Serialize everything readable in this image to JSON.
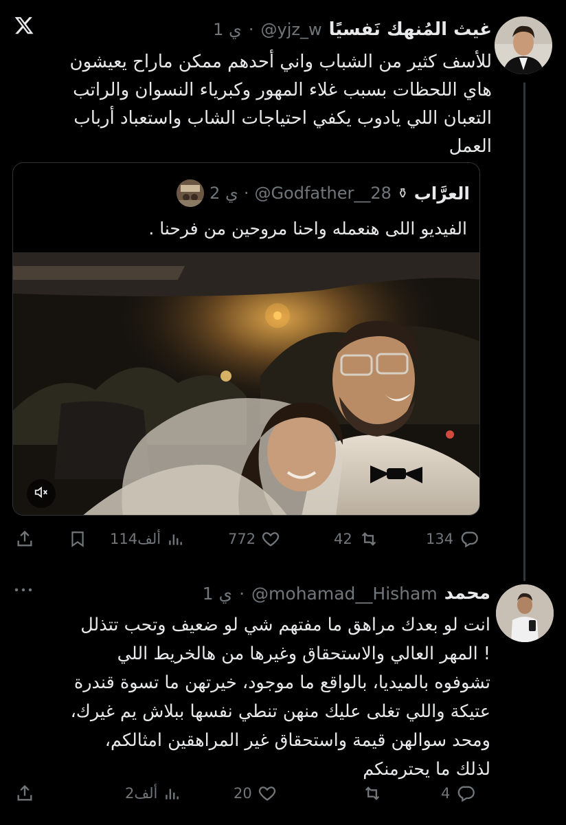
{
  "tweet": {
    "display_name": "غيث المُنهك نَفسيًا",
    "handle": "@yjz_w",
    "time": "1 ي",
    "text_lines": [
      "للأسف كثير من الشباب واني أحدهم ممكن ماراح يعيشون",
      "هاي اللحظات بسبب غلاء المهور وكبرياء النسوان والراتب",
      "التعبان اللي يادوب يكفي احتياجات الشاب واستعباد أرباب",
      "العمل"
    ],
    "quote": {
      "display_name": "العرَّاب",
      "badge": "⚱",
      "handle": "@Godfather__28",
      "time": "2 ي",
      "text": "الفيديو اللى هنعمله واحنا مروحين من فرحنا ."
    },
    "actions": {
      "replies": "134",
      "retweets": "42",
      "likes": "772",
      "views": "114ألف"
    }
  },
  "reply": {
    "display_name": "محمد",
    "handle": "@mohamad__Hisham",
    "time": "1 ي",
    "text_lines": [
      "انت لو بعدك مراهق ما مفتهم شي لو ضعيف وتحب تتذلل",
      "! المهر العالي والاستحقاق وغيرها من هالخريط اللي",
      "تشوفوه بالميديا، بالواقع ما موجود، خيرتهن ما تسوة قندرة",
      "عتيكة واللي تغلى عليك منهن تنطي نفسها ببلاش يم غيرك،",
      "ومحد سوالهن قيمة واستحقاق غير المراهقين امثالكم،",
      "لذلك ما يحترمنكم"
    ],
    "actions": {
      "replies": "4",
      "likes": "20",
      "views": "2ألف"
    }
  },
  "icons": {
    "logo": "x-logo-icon",
    "reply": "reply-bubble-icon",
    "retweet": "retweet-icon",
    "like": "heart-icon",
    "views": "views-bars-icon",
    "bookmark": "bookmark-icon",
    "share": "share-upload-icon",
    "mute": "speaker-muted-icon",
    "more": "more-dots-icon"
  },
  "colors": {
    "background": "#000000",
    "text": "#e7e9ea",
    "muted": "#71767b",
    "border": "#2f3336"
  }
}
